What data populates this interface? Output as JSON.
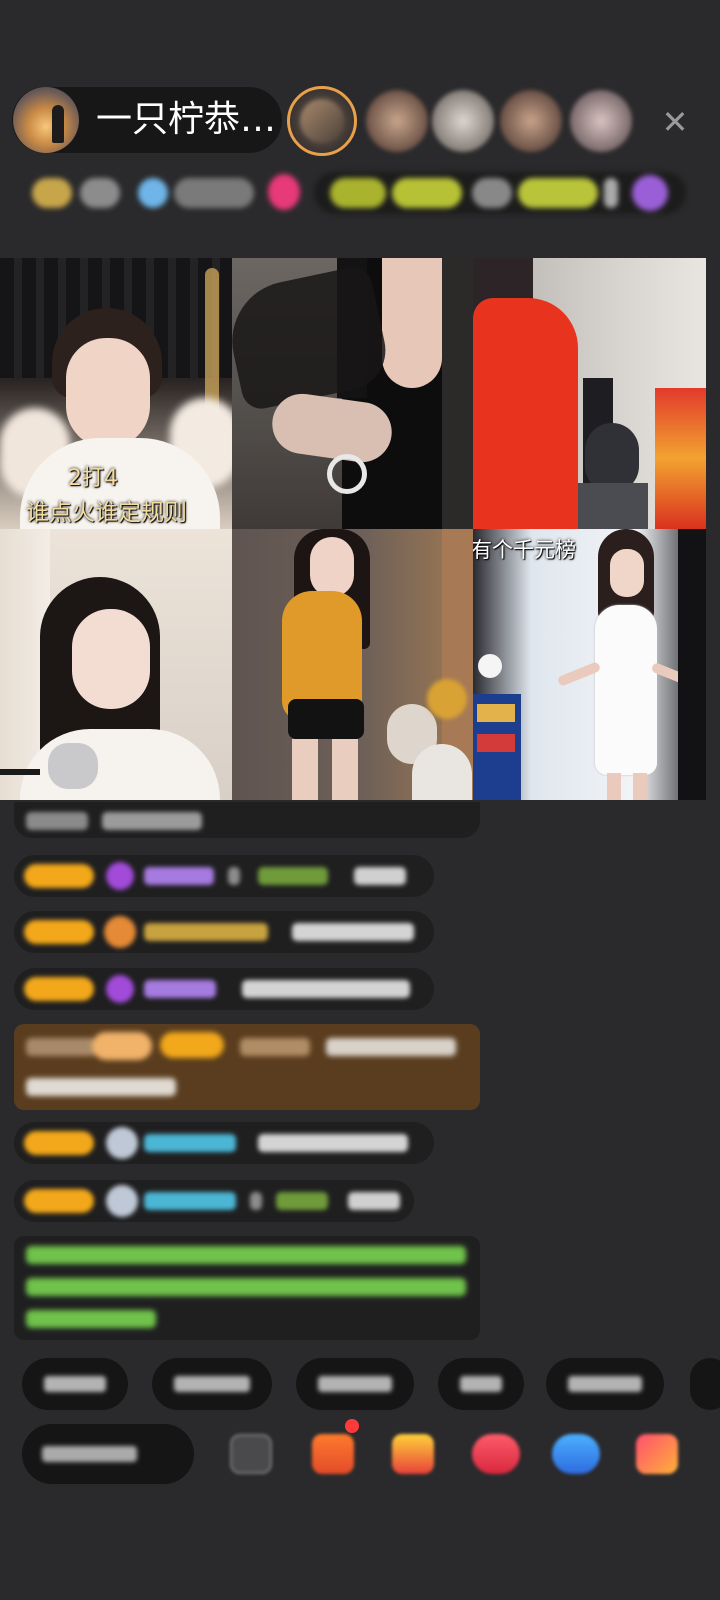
{
  "header": {
    "host_name": "一只柠恭…",
    "close_icon": "close-icon",
    "viewer_count": 5
  },
  "video_grid": {
    "captions": {
      "tile1_line1": "2打4",
      "tile1_line2": "谁点火谁定规则",
      "tile6_top": "有个千元榜"
    },
    "tiles": 6
  },
  "chat": {
    "message_count": 8,
    "colors": {
      "badge": "#f2a81a",
      "gift_highlight": "#5a3d1e",
      "system_text": "#6fc24a",
      "username_purple": "#a67be0",
      "username_cyan": "#4bb6d4"
    }
  },
  "bottom_bar": {
    "quick_replies": 6,
    "icons": [
      "more-icon",
      "gift-box-icon",
      "treasure-icon",
      "lips-icon",
      "game-icon",
      "grid-icon"
    ]
  }
}
